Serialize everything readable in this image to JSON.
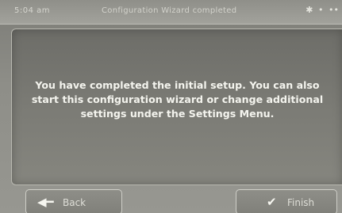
{
  "statusbar": {
    "time": "5:04 am",
    "title": "Configuration Wizard completed",
    "icons": [
      "bluetooth-icon",
      "signal-icon",
      "menu-dots-icon"
    ],
    "bluetooth_glyph": "✱",
    "signal_glyph": "•",
    "dots_glyph": "••"
  },
  "main": {
    "message_line1": "You have completed the initial setup. You can also",
    "message_line2": "start this configuration wizard or change additional",
    "message_line3": "settings under the Settings Menu."
  },
  "buttons": {
    "back_label": "Back",
    "back_icon": "◀━",
    "finish_label": "Finish",
    "finish_icon": "✔"
  }
}
